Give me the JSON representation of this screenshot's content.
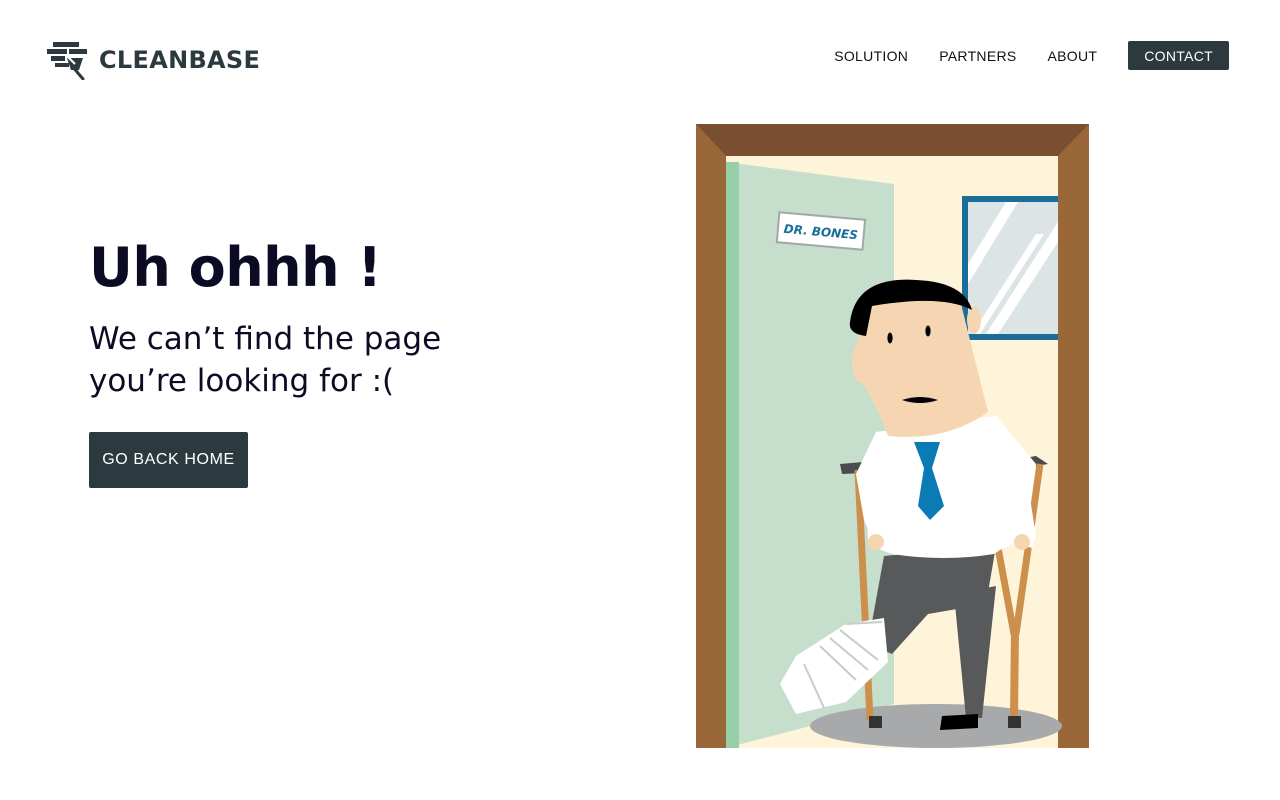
{
  "brand": {
    "name": "CLEANBASE",
    "logo_icon": "broom-mop-icon"
  },
  "nav": {
    "links": [
      "SOLUTION",
      "PARTNERS",
      "ABOUT"
    ],
    "cta": "CONTACT"
  },
  "main": {
    "headline": "Uh ohhh !",
    "subtext": "We can’t find the page you’re looking for :(",
    "button_label": "GO BACK HOME"
  },
  "illustration": {
    "door_sign": "DR. BONES"
  },
  "colors": {
    "dark": "#2c3a40",
    "text": "#0b0b24",
    "door_frame": "#9a6838",
    "door_frame_top": "#7a4f30",
    "door": "#c6dfcd",
    "door_edge": "#97cfa8",
    "wall": "#fdf4d9",
    "tie": "#0a7bb4",
    "window_frame": "#1b6e99"
  }
}
